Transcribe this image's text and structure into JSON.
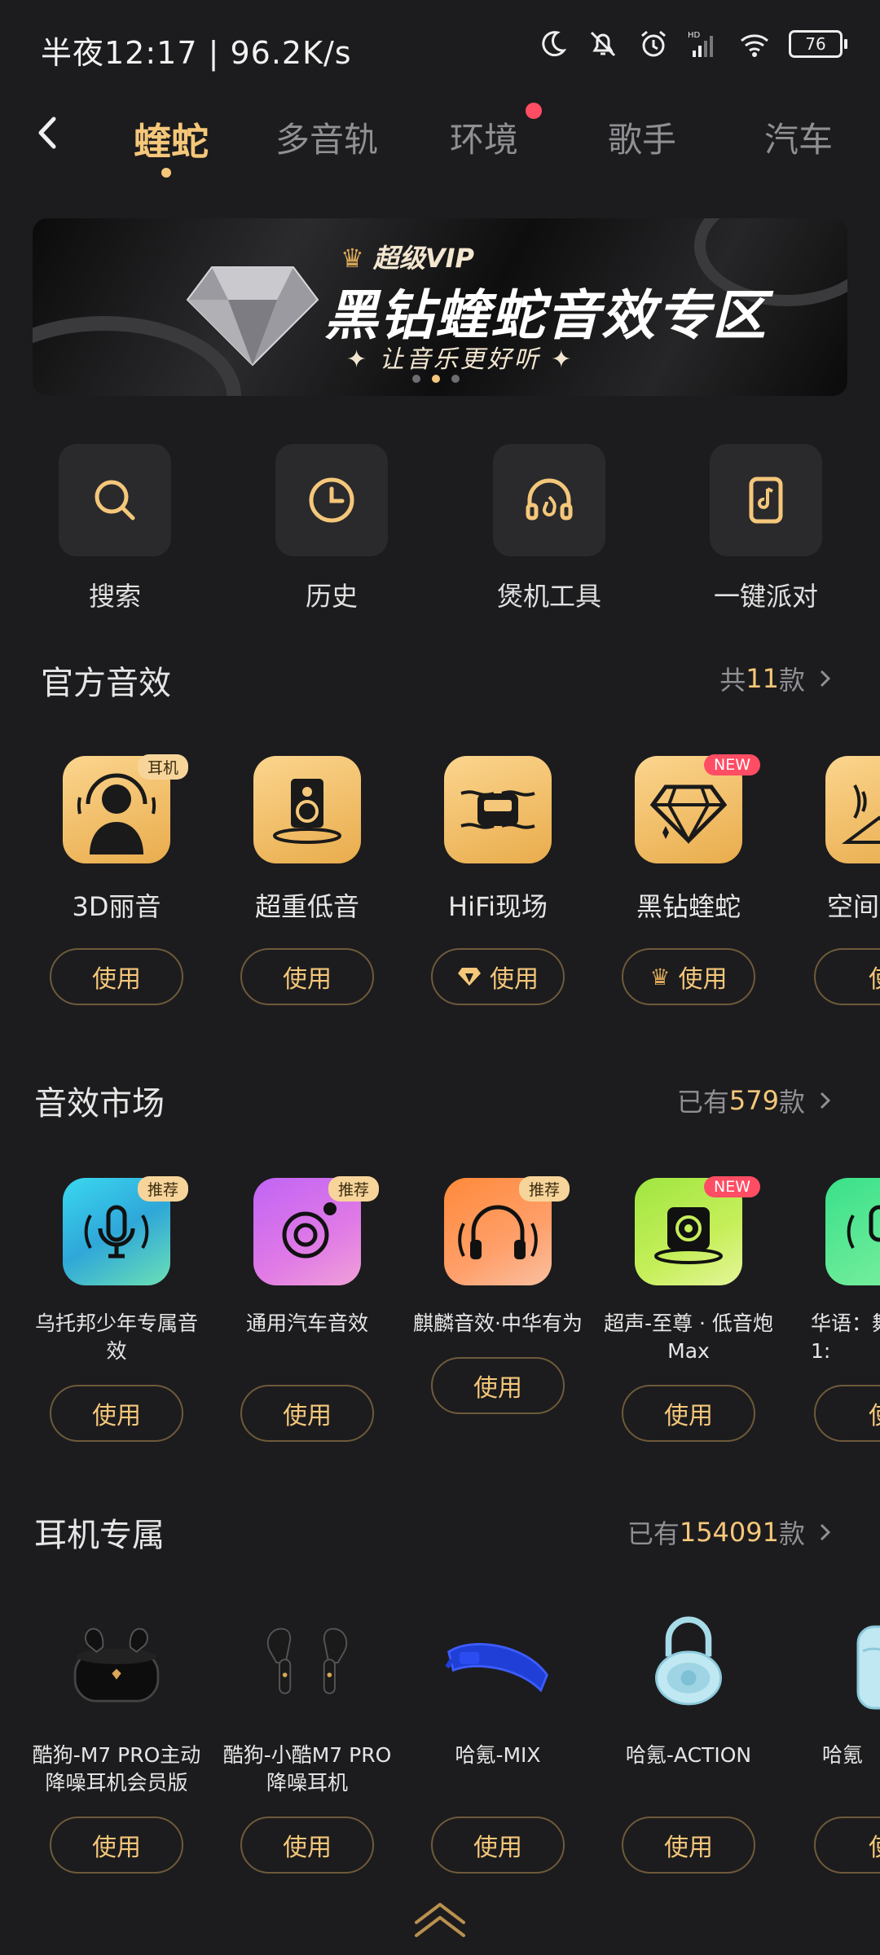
{
  "status_bar": {
    "time": "半夜12:17 | 96.2K/s",
    "battery": "76"
  },
  "tabs": [
    {
      "label": "蝰蛇",
      "active": true
    },
    {
      "label": "多音轨"
    },
    {
      "label": "环境",
      "has_dot": true
    },
    {
      "label": "歌手"
    },
    {
      "label": "汽车"
    }
  ],
  "banner": {
    "vip_label": "超级VIP",
    "title": "黑钻蝰蛇音效专区",
    "subtitle": "✦ 让音乐更好听 ✦",
    "page_count": 3,
    "current_page": 2
  },
  "tools": [
    {
      "label": "搜索",
      "icon": "search-icon"
    },
    {
      "label": "历史",
      "icon": "clock-icon"
    },
    {
      "label": "煲机工具",
      "icon": "headphone-fire-icon"
    },
    {
      "label": "一键派对",
      "icon": "phone-music-icon"
    }
  ],
  "official": {
    "title": "官方音效",
    "more_prefix": "共",
    "more_count": "11",
    "more_suffix": "款",
    "items": [
      {
        "name": "3D丽音",
        "badge": "耳机",
        "button": "使用"
      },
      {
        "name": "超重低音",
        "button": "使用"
      },
      {
        "name": "HiFi现场",
        "button": "使用",
        "btn_icon": "diamond"
      },
      {
        "name": "黑钻蝰蛇",
        "badge": "NEW",
        "button": "使用",
        "btn_icon": "crown"
      },
      {
        "name": "空间",
        "button": "使"
      }
    ]
  },
  "market": {
    "title": "音效市场",
    "more_prefix": "已有",
    "more_count": "579",
    "more_suffix": "款",
    "items": [
      {
        "name": "乌托邦少年专属音效",
        "badge": "推荐",
        "button": "使用"
      },
      {
        "name": "通用汽车音效",
        "badge": "推荐",
        "button": "使用"
      },
      {
        "name": "麒麟音效·中华有为",
        "badge": "推荐",
        "button": "使用"
      },
      {
        "name": "超声-至尊 · 低音炮Max",
        "badge": "NEW",
        "button": "使用"
      },
      {
        "name": "华语：舞 1:",
        "button": "使"
      }
    ]
  },
  "earphones": {
    "title": "耳机专属",
    "more_prefix": "已有",
    "more_count": "154091",
    "more_suffix": "款",
    "items": [
      {
        "name": "酷狗-M7 PRO主动降噪耳机会员版",
        "button": "使用"
      },
      {
        "name": "酷狗-小酷M7 PRO降噪耳机",
        "button": "使用"
      },
      {
        "name": "哈氪-MIX",
        "button": "使用"
      },
      {
        "name": "哈氪-ACTION",
        "button": "使用"
      },
      {
        "name": "哈氪",
        "button": "使"
      }
    ]
  },
  "colors": {
    "accent": "#f5c77a",
    "background": "#1c1c1e",
    "new_badge": "#ff4d64"
  }
}
